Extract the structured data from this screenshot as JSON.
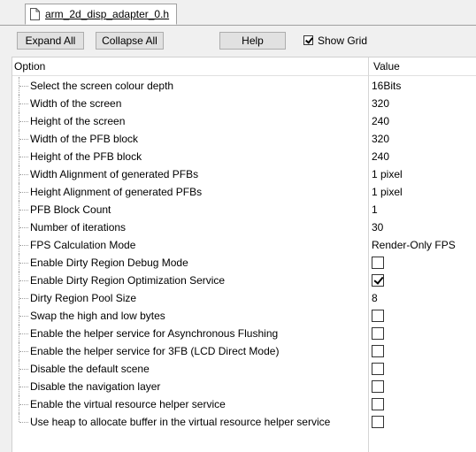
{
  "tab": {
    "label": "arm_2d_disp_adapter_0.h",
    "icon": "file-icon"
  },
  "toolbar": {
    "expand_label": "Expand All",
    "collapse_label": "Collapse All",
    "help_label": "Help",
    "show_grid_label": "Show Grid",
    "show_grid_checked": true
  },
  "grid": {
    "header_option": "Option",
    "header_value": "Value",
    "rows": [
      {
        "label": "Select the screen colour depth",
        "value": "16Bits",
        "type": "text"
      },
      {
        "label": "Width of the screen",
        "value": "320",
        "type": "text"
      },
      {
        "label": "Height of the screen",
        "value": "240",
        "type": "text"
      },
      {
        "label": "Width of the PFB block",
        "value": "320",
        "type": "text"
      },
      {
        "label": "Height of the PFB block",
        "value": "240",
        "type": "text"
      },
      {
        "label": "Width Alignment of generated PFBs",
        "value": "1 pixel",
        "type": "text"
      },
      {
        "label": "Height Alignment of generated PFBs",
        "value": "1 pixel",
        "type": "text"
      },
      {
        "label": "PFB Block Count",
        "value": "1",
        "type": "text"
      },
      {
        "label": "Number of iterations",
        "value": "30",
        "type": "text"
      },
      {
        "label": "FPS Calculation Mode",
        "value": "Render-Only FPS",
        "type": "text"
      },
      {
        "label": "Enable Dirty Region Debug Mode",
        "checked": false,
        "type": "checkbox"
      },
      {
        "label": "Enable Dirty Region Optimization Service",
        "checked": true,
        "type": "checkbox"
      },
      {
        "label": "Dirty Region Pool Size",
        "value": "8",
        "type": "text"
      },
      {
        "label": "Swap the high and low bytes",
        "checked": false,
        "type": "checkbox"
      },
      {
        "label": "Enable the helper service for Asynchronous Flushing",
        "checked": false,
        "type": "checkbox"
      },
      {
        "label": "Enable the helper service for 3FB (LCD Direct Mode)",
        "checked": false,
        "type": "checkbox"
      },
      {
        "label": "Disable the default scene",
        "checked": false,
        "type": "checkbox"
      },
      {
        "label": "Disable the navigation layer",
        "checked": false,
        "type": "checkbox"
      },
      {
        "label": "Enable the virtual resource helper service",
        "checked": false,
        "type": "checkbox"
      },
      {
        "label": "Use heap to allocate buffer in the virtual resource helper service",
        "checked": false,
        "type": "checkbox"
      }
    ]
  }
}
